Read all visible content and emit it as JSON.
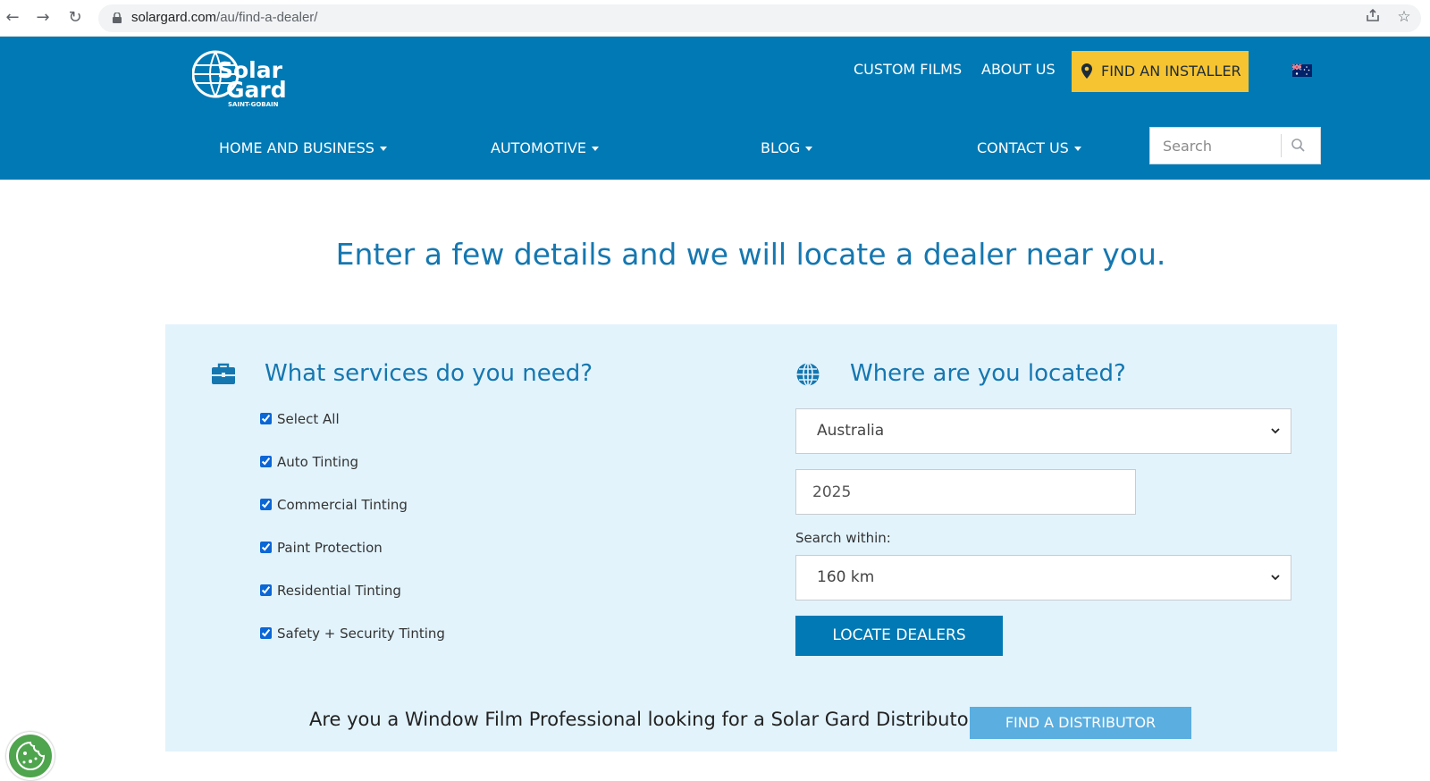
{
  "browser": {
    "url_domain": "solargard.com",
    "url_path": "/au/find-a-dealer/"
  },
  "header": {
    "logo_text": "Solar Gard",
    "logo_subtext": "SAINT-GOBAIN",
    "top_links": [
      "CUSTOM FILMS",
      "ABOUT US"
    ],
    "installer_button": "FIND AN INSTALLER",
    "nav_items": [
      "HOME AND BUSINESS",
      "AUTOMOTIVE",
      "BLOG",
      "CONTACT US"
    ],
    "search_placeholder": "Search"
  },
  "main": {
    "heading": "Enter a few details and we will locate a dealer near you.",
    "services": {
      "title": "What services do you need?",
      "options": [
        {
          "label": "Select All",
          "checked": true
        },
        {
          "label": "Auto Tinting",
          "checked": true
        },
        {
          "label": "Commercial Tinting",
          "checked": true
        },
        {
          "label": "Paint Protection",
          "checked": true
        },
        {
          "label": "Residential Tinting",
          "checked": true
        },
        {
          "label": "Safety + Security Tinting",
          "checked": true
        }
      ]
    },
    "location": {
      "title": "Where are you located?",
      "country": "Australia",
      "postcode": "2025",
      "within_label": "Search within:",
      "radius": "160 km",
      "submit": "LOCATE DEALERS"
    },
    "distributor": {
      "text": "Are you a Window Film Professional looking for a Solar Gard Distributor?",
      "button": "FIND A DISTRIBUTOR"
    }
  },
  "colors": {
    "header_blue": "#0079b4",
    "installer_yellow": "#f7c431",
    "heading_blue": "#1577b0",
    "panel_bg": "#e2f3fc",
    "distributor_button": "#5aaee0",
    "cookie_green": "#4fa44e"
  }
}
